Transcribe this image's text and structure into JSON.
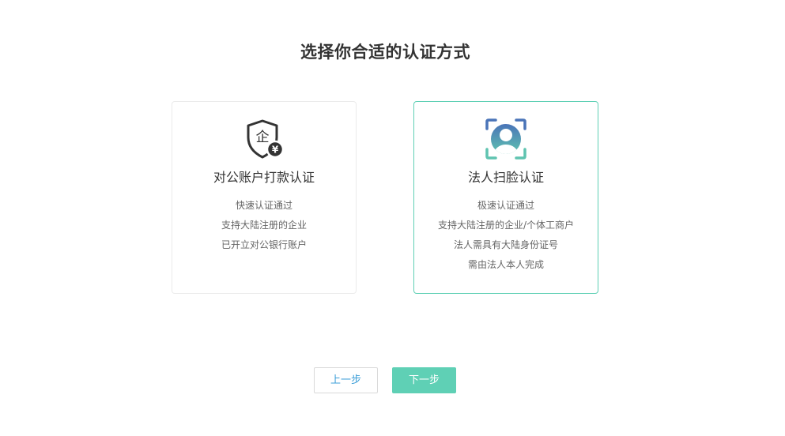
{
  "page": {
    "title": "选择你合适的认证方式"
  },
  "options": [
    {
      "title": "对公账户打款认证",
      "icon": "shield-enterprise-yen-icon",
      "icon_glyph": "企",
      "badge_glyph": "¥",
      "selected": false,
      "features": [
        "快速认证通过",
        "支持大陆注册的企业",
        "已开立对公银行账户"
      ]
    },
    {
      "title": "法人扫脸认证",
      "icon": "face-scan-icon",
      "selected": true,
      "features": [
        "极速认证通过",
        "支持大陆注册的企业/个体工商户",
        "法人需具有大陆身份证号",
        "需由法人本人完成"
      ]
    }
  ],
  "buttons": {
    "prev_label": "上一步",
    "next_label": "下一步"
  },
  "colors": {
    "accent": "#5fd0b5",
    "link_blue": "#3e9fd8",
    "icon_dark": "#333333",
    "scan_blue": "#4a74b8",
    "scan_teal": "#5fc4b0"
  }
}
